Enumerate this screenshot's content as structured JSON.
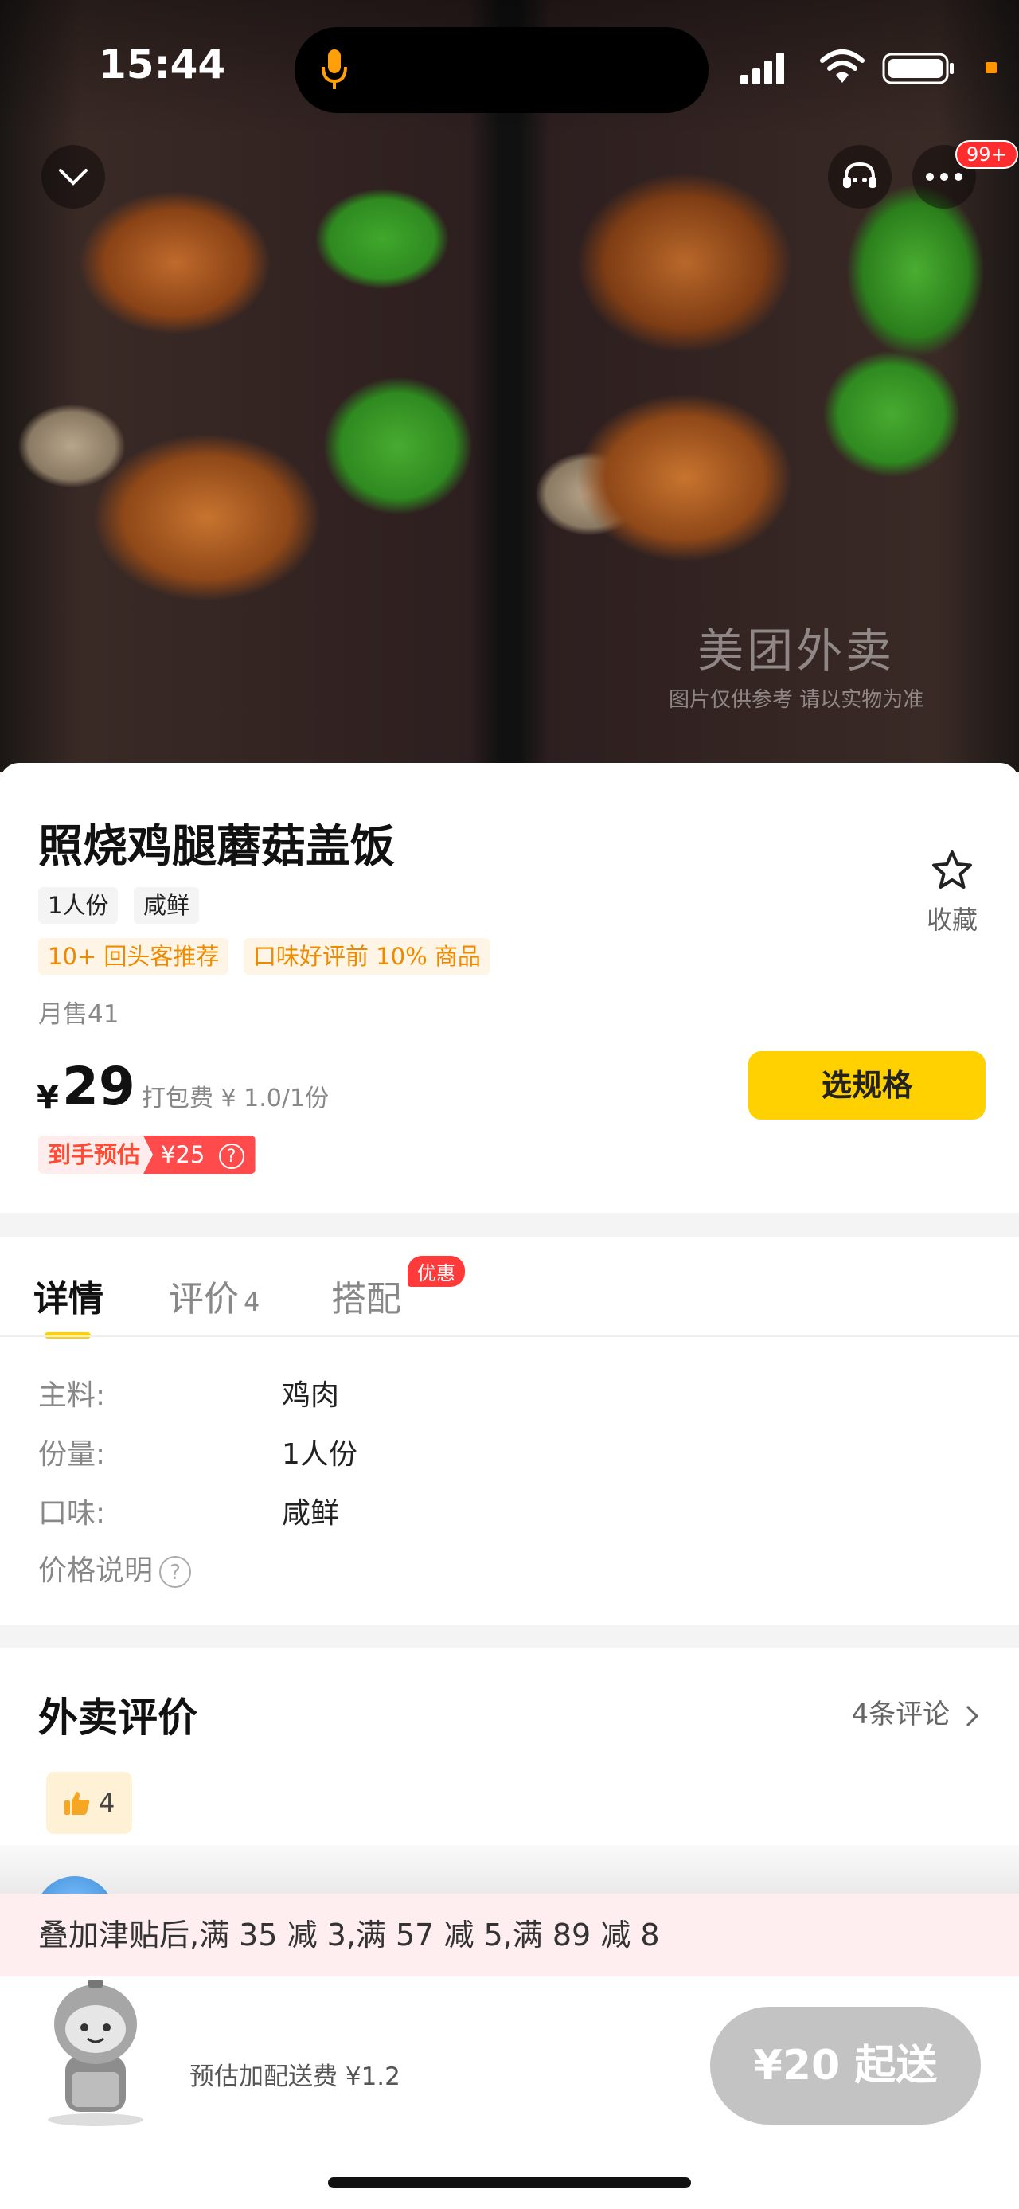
{
  "status_bar": {
    "time": "15:44",
    "notification_badge": "99+"
  },
  "hero": {
    "watermark_brand": "美团外卖",
    "watermark_note": "图片仅供参考 请以实物为准"
  },
  "product": {
    "title": "照烧鸡腿蘑菇盖饭",
    "tags": [
      "1人份",
      "咸鲜"
    ],
    "promos": [
      "10+ 回头客推荐",
      "口味好评前 10% 商品"
    ],
    "sales": "月售41",
    "price_symbol": "¥",
    "price": "29",
    "packaging": "打包费 ¥ 1.0/1份",
    "estimate_label": "到手预估",
    "estimate_price": "¥25",
    "favorite_label": "收藏",
    "choose_button": "选规格"
  },
  "tabs": [
    {
      "label": "详情"
    },
    {
      "label": "评价",
      "count": "4"
    },
    {
      "label": "搭配",
      "badge": "优惠"
    }
  ],
  "details": [
    {
      "label": "主料:",
      "value": "鸡肉"
    },
    {
      "label": "份量:",
      "value": "1人份"
    },
    {
      "label": "口味:",
      "value": "咸鲜"
    },
    {
      "label": "价格说明",
      "value": ""
    }
  ],
  "reviews": {
    "title": "外卖评价",
    "link": "4条评论",
    "likes": "4"
  },
  "subsidy": "叠加津贴后,满 35 减 3,满 57 减 5,满 89 减 8",
  "bottom": {
    "shipping_fee": "预估加配送费 ¥1.2",
    "min_order": "¥20 起送"
  },
  "colors": {
    "accent": "#ffd100",
    "promo_text": "#ef8a00",
    "price_red": "#ff4b4b"
  }
}
